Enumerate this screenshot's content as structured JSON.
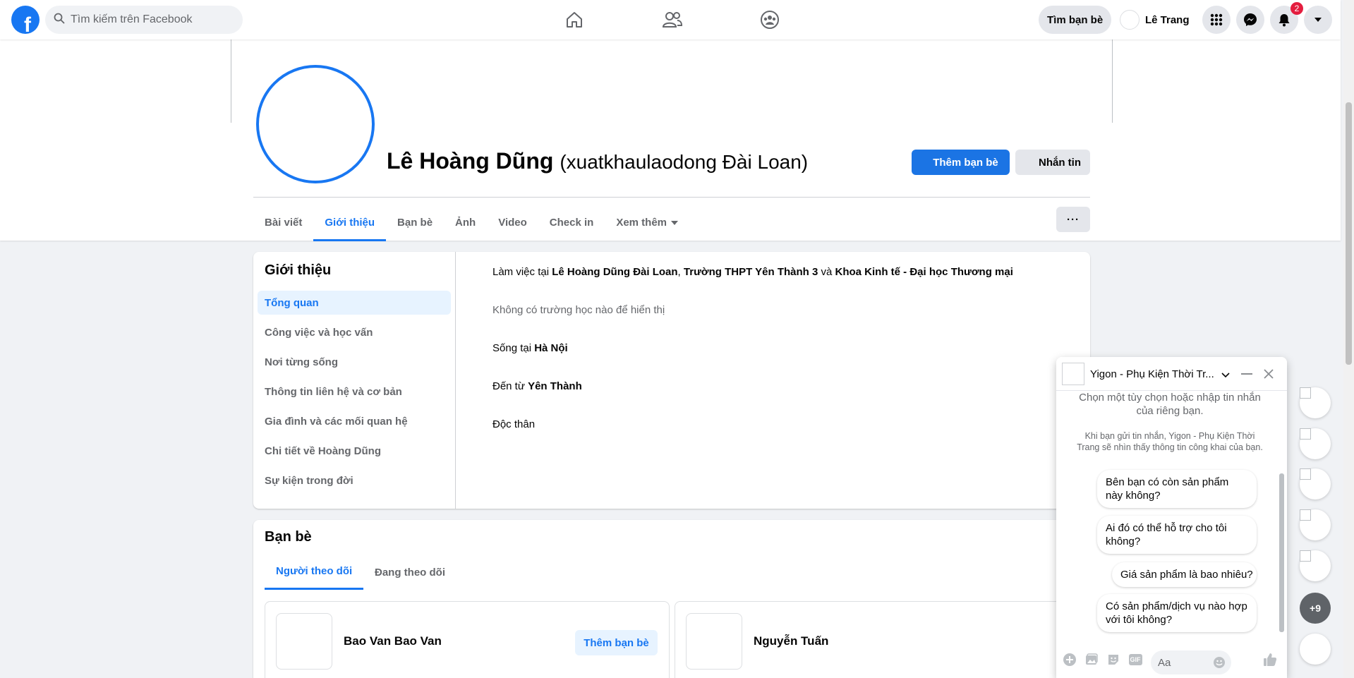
{
  "topbar": {
    "search_placeholder": "Tìm kiếm trên Facebook",
    "find_friends": "Tìm bạn bè",
    "user_name": "Lê Trang",
    "notifications_count": "2"
  },
  "profile": {
    "name": "Lê Hoàng Dũng",
    "alternate_name": "(xuatkhaulaodong Đài Loan)",
    "add_friend": "Thêm bạn bè",
    "message": "Nhắn tin",
    "tabs": [
      "Bài viết",
      "Giới thiệu",
      "Bạn bè",
      "Ảnh",
      "Video",
      "Check in",
      "Xem thêm"
    ],
    "more_dots": "···"
  },
  "intro": {
    "title": "Giới thiệu",
    "nav": [
      "Tổng quan",
      "Công việc và học vấn",
      "Nơi từng sống",
      "Thông tin liên hệ và cơ bản",
      "Gia đình và các mối quan hệ",
      "Chi tiết về Hoàng Dũng",
      "Sự kiện trong đời"
    ],
    "work_prefix": "Làm việc tại ",
    "work_1": "Lê Hoàng Dũng Đài Loan",
    "work_sep": ", ",
    "work_2": "Trường THPT Yên Thành 3",
    "work_and": " và ",
    "work_3": "Khoa Kinh tế - Đại học Thương mại",
    "no_school": "Không có trường học nào để hiển thị",
    "lives_prefix": "Sống tại ",
    "lives_in": "Hà Nội",
    "from_prefix": "Đến từ ",
    "from": "Yên Thành",
    "relationship": "Độc thân"
  },
  "friends": {
    "title": "Bạn bè",
    "tabs": [
      "Người theo dõi",
      "Đang theo dõi"
    ],
    "list": [
      {
        "name": "Bao Van Bao Van",
        "action": "Thêm bạn bè"
      },
      {
        "name": "Nguyễn Tuấn"
      }
    ]
  },
  "chat": {
    "title": "Yigon - Phụ Kiện Thời Tr...",
    "prompt": "Chọn một tùy chọn hoặc nhập tin nhắn của riêng bạn.",
    "notice": "Khi bạn gửi tin nhắn, Yigon - Phụ Kiện Thời Trang sẽ nhìn thấy thông tin công khai của bạn.",
    "suggestions": [
      "Bên bạn có còn sản phẩm này không?",
      "Ai đó có thể hỗ trợ cho tôi không?",
      "Giá sản phẩm là bao nhiêu?",
      "Có sản phẩm/dịch vụ nào hợp với tôi không?"
    ],
    "input_placeholder": "Aa",
    "gif": "GIF"
  },
  "chat_heads": {
    "more_count": "+9"
  },
  "colors": {
    "accent": "#1877f2",
    "badge": "#e41e3f"
  }
}
